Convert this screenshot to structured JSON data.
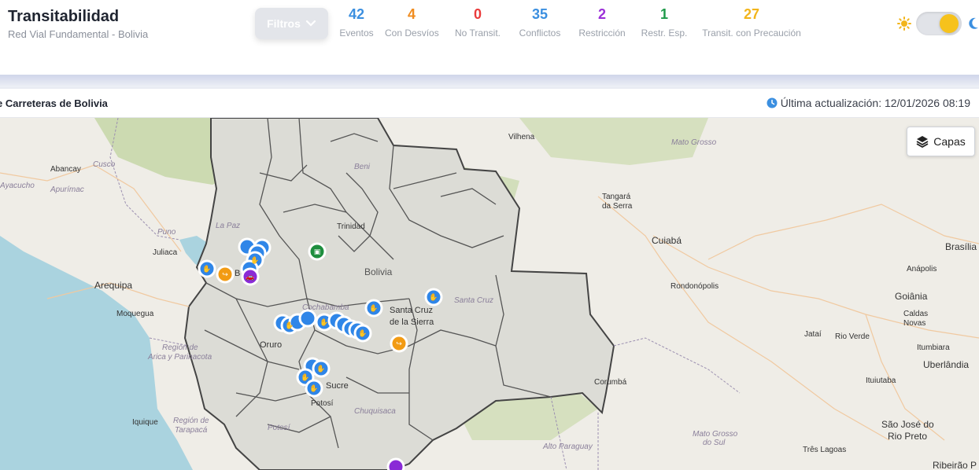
{
  "header": {
    "title": "Transitabilidad",
    "subtitle": "Red Vial Fundamental - Bolivia",
    "filter_label": "Filtros"
  },
  "stats": [
    {
      "value": "42",
      "label": "Eventos",
      "color": "#3b8fe0"
    },
    {
      "value": "4",
      "label": "Con Desvíos",
      "color": "#f08c1f"
    },
    {
      "value": "0",
      "label": "No Transit.",
      "color": "#ea3b3b"
    },
    {
      "value": "35",
      "label": "Conflictos",
      "color": "#3b8fe0"
    },
    {
      "value": "2",
      "label": "Restricción",
      "color": "#9b30d8"
    },
    {
      "value": "1",
      "label": "Restr. Esp.",
      "color": "#1f9a4a"
    },
    {
      "value": "27",
      "label": "Transit. con Precaución",
      "color": "#f2b51b"
    }
  ],
  "theme_toggle": {
    "state": "light",
    "icons": [
      "sun-icon",
      "moon-icon"
    ]
  },
  "mapbar": {
    "title": "e Carreteras de Bolivia",
    "last_update": "Última actualización: 12/01/2026 08:19"
  },
  "map": {
    "layers_label": "Capas",
    "place_labels": {
      "vilhena": "Vilhena",
      "mato_grosso": "Mato Grosso",
      "abancay": "Abancay",
      "cusco": "Cusco",
      "ayacucho": "Ayacucho",
      "apurimac": "Apurímac",
      "beni": "Beni",
      "tangara1": "Tangará",
      "tangara2": "da Serra",
      "trinidad": "Trinidad",
      "puno": "Puno",
      "juliaca": "Juliaca",
      "lapaz_dep": "La Paz",
      "cuiaba": "Cuiabá",
      "brasilia": "Brasília",
      "bolivia": "Bolivia",
      "arequipa": "Arequipa",
      "rondonopolis": "Rondonópolis",
      "anapolis": "Anápolis",
      "santacruz_dep": "Santa Cruz",
      "goiania": "Goiânia",
      "moquegua": "Moquegua",
      "santacruz1": "Santa Cruz",
      "santacruz2": "de la Sierra",
      "caldas1": "Caldas",
      "caldas2": "Novas",
      "cochabamba": "Cochabamba",
      "region_arica1": "Región de",
      "region_arica2": "Arica y Parinacota",
      "oruro": "Oruro",
      "jatai": "Jataí",
      "rioverde": "Rio Verde",
      "itumbiara": "Itumbiara",
      "uberlandia": "Uberlândia",
      "ituiutaba": "Ituiutaba",
      "corumba": "Corumbá",
      "sucre": "Sucre",
      "potosi": "Potosí",
      "iquique": "Iquique",
      "region_tarapaca1": "Región de",
      "region_tarapaca2": "Tarapacá",
      "chuquisaca": "Chuquisaca",
      "potosi_dep": "Potosí",
      "sjrp1": "São José do",
      "sjrp2": "Rio Preto",
      "msul1": "Mato Grosso",
      "msul2": "do Sul",
      "altoparaguay": "Alto Paraguay",
      "treslagoas": "Três Lagoas",
      "ribeirao": "Ribeirão P"
    }
  },
  "colors": {
    "marker_blue": "#2f86e8",
    "marker_orange": "#f29b13",
    "marker_purple": "#8a2bd6",
    "marker_green": "#1e8e3e",
    "water": "#aad3df",
    "bolivia_fill": "#dcdcd6",
    "forest": "#c8d7ab"
  }
}
